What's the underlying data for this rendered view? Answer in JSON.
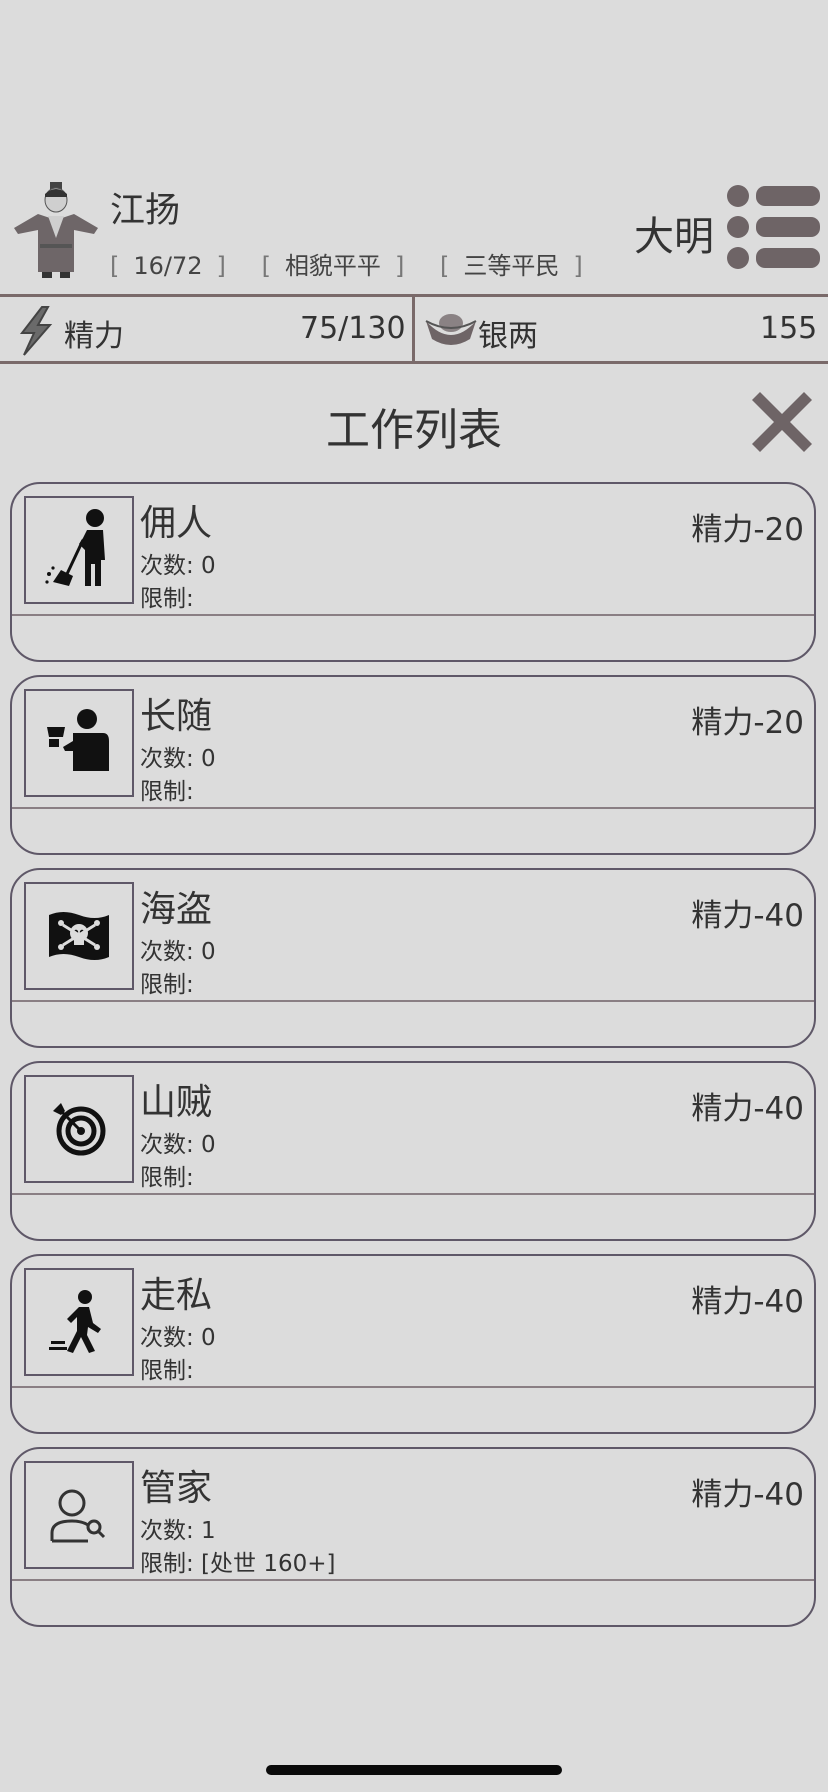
{
  "player": {
    "name": "江扬",
    "tags": [
      "16/72",
      "相貌平平",
      "三等平民"
    ],
    "dynasty": "大明"
  },
  "resources": {
    "energy_label": "精力",
    "energy_value": "75/130",
    "silver_label": "银两",
    "silver_value": "155"
  },
  "panel": {
    "title": "工作列表"
  },
  "jobs": [
    {
      "name": "佣人",
      "count": "次数: 0",
      "limit": "限制:",
      "cost": "精力-20",
      "icon": "sweeper-icon"
    },
    {
      "name": "长随",
      "count": "次数: 0",
      "limit": "限制:",
      "cost": "精力-20",
      "icon": "attendant-icon"
    },
    {
      "name": "海盗",
      "count": "次数: 0",
      "limit": "限制:",
      "cost": "精力-40",
      "icon": "pirate-flag-icon"
    },
    {
      "name": "山贼",
      "count": "次数: 0",
      "limit": "限制:",
      "cost": "精力-40",
      "icon": "target-icon"
    },
    {
      "name": "走私",
      "count": "次数: 0",
      "limit": "限制:",
      "cost": "精力-40",
      "icon": "walking-person-icon"
    },
    {
      "name": "管家",
      "count": "次数: 1",
      "limit": "限制: [处世 160+]",
      "cost": "精力-40",
      "icon": "person-search-icon"
    }
  ],
  "colors": {
    "background": "#dcdcdc",
    "border": "#5f5868",
    "icon_dark": "#6e6466"
  }
}
